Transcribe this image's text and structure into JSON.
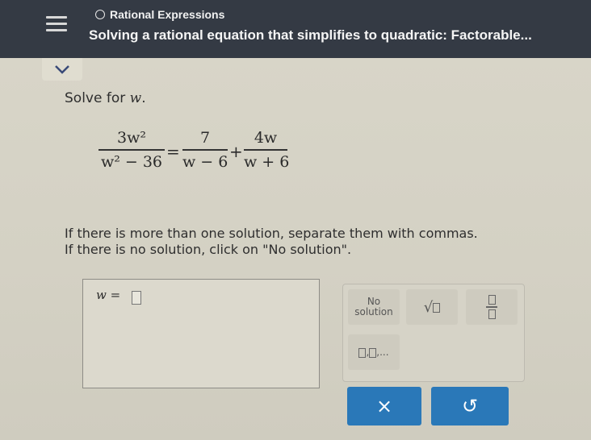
{
  "header": {
    "topic": "Rational Expressions",
    "title": "Solving a rational equation that simplifies to quadratic: Factorable..."
  },
  "problem": {
    "prompt": "Solve for",
    "variable": "w",
    "prompt_end": ".",
    "equation": {
      "lhs_num": "3w²",
      "lhs_den": "w² − 36",
      "equals": "=",
      "term1_num": "7",
      "term1_den": "w − 6",
      "plus": "+",
      "term2_num": "4w",
      "term2_den": "w + 6"
    },
    "instruction_line1": "If there is more than one solution, separate them with commas.",
    "instruction_line2": "If there is no solution, click on \"No solution\"."
  },
  "answer": {
    "label": "w ="
  },
  "keypad": {
    "no_solution_line1": "No",
    "no_solution_line2": "solution",
    "list_suffix": ",..."
  },
  "buttons": {
    "clear": "×",
    "undo": "↺"
  },
  "colors": {
    "header_bg": "#343a44",
    "button_bg": "#2a78b8"
  }
}
